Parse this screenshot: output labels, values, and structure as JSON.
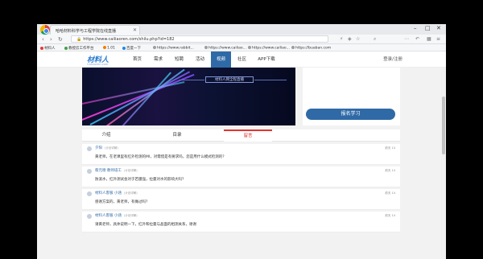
{
  "browser": {
    "tab_title": "哈哈材料科学与工程学院在线直播",
    "url": "https://www.cailiaoren.com/shilu.php?id=182",
    "bookmarks": [
      {
        "label": "材料人",
        "color": "#e53935"
      },
      {
        "label": "教授云工作平台",
        "color": "#43a047"
      },
      {
        "label": "1.01",
        "color": "#f57c00"
      },
      {
        "label": "百度一下",
        "color": "#1e88e5"
      },
      {
        "label": "https://www.rabbit...",
        "color": "#9e9e9e"
      },
      {
        "label": "https://www.cailiao...",
        "color": "#9e9e9e"
      },
      {
        "label": "https://www.cailiao...",
        "color": "#9e9e9e"
      },
      {
        "label": "https://buaban.com",
        "color": "#9e9e9e"
      }
    ]
  },
  "site": {
    "logo_text": "材料人",
    "logo_sub": "Cailiaoren.com",
    "nav": [
      "首页",
      "需求",
      "短聘",
      "活动",
      "视频",
      "社区",
      "APP下载"
    ],
    "active_nav_index": 4,
    "login": "登录/注册"
  },
  "banner": {
    "caption": "材料人网全程直播"
  },
  "side": {
    "signup_label": "报名学习"
  },
  "tabs": [
    "介绍",
    "目录",
    "留言"
  ],
  "active_tab_index": 2,
  "comments": [
    {
      "user": "夕阳",
      "tag": "(计划详解)",
      "time": "前天 14",
      "text": "黄老师，在老课里有红外检测的MI，对需借是有要求吗，您是用什么模式检测的？"
    },
    {
      "user": "蔡元德  教师培工",
      "tag": "(计划详解)",
      "time": "前天 14",
      "text": "防滚水，红外测试会对于若膜强，拉曼对水的影响大吗？"
    },
    {
      "user": "材料人客服 小涵",
      "tag": "(计划详解)",
      "time": "前天 14",
      "text": "感谢方案的，黄老师，有做过吗？"
    },
    {
      "user": "材料人客服 小涵",
      "tag": "(计划详解)",
      "time": "前天 14",
      "text": "请黄老师，具体说明一下，红外和拉曼与晶面的相测关系，谢谢"
    }
  ],
  "colors": {
    "nav_active": "#2f6aa7",
    "tab_active": "#e3342f",
    "button": "#2f6aa7"
  }
}
